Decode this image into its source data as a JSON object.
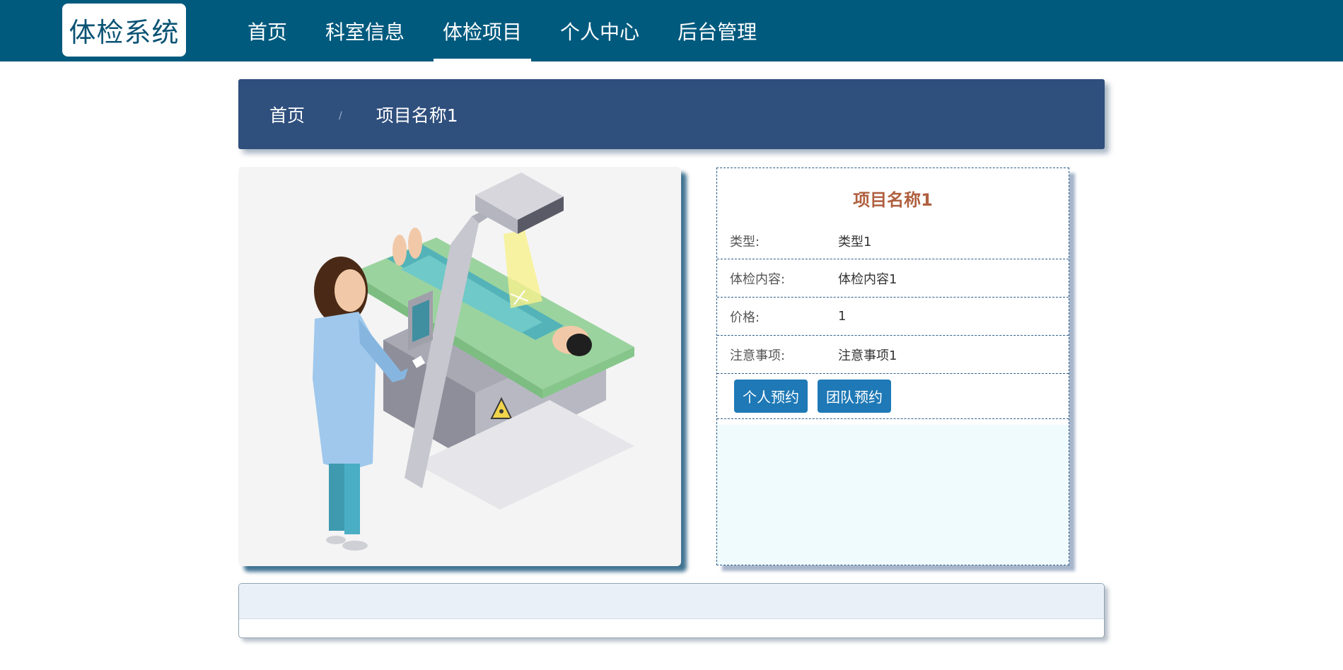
{
  "app": {
    "logo": "体检系统"
  },
  "nav": {
    "items": [
      {
        "label": "首页"
      },
      {
        "label": "科室信息"
      },
      {
        "label": "体检项目"
      },
      {
        "label": "个人中心"
      },
      {
        "label": "后台管理"
      }
    ],
    "active_index": 2
  },
  "breadcrumb": {
    "home": "首页",
    "separator": "/",
    "current": "项目名称1"
  },
  "detail": {
    "title": "项目名称1",
    "fields": [
      {
        "label": "类型:",
        "value": "类型1"
      },
      {
        "label": "体检内容:",
        "value": "体检内容1"
      },
      {
        "label": "价格:",
        "value": "1"
      },
      {
        "label": "注意事项:",
        "value": "注意事项1"
      }
    ],
    "buttons": {
      "personal": "个人预约",
      "team": "团队预约"
    }
  },
  "colors": {
    "nav_bg": "#005a7e",
    "breadcrumb_bg": "#2f4f7d",
    "title_color": "#b06040",
    "button_bg": "#1e79b6"
  }
}
